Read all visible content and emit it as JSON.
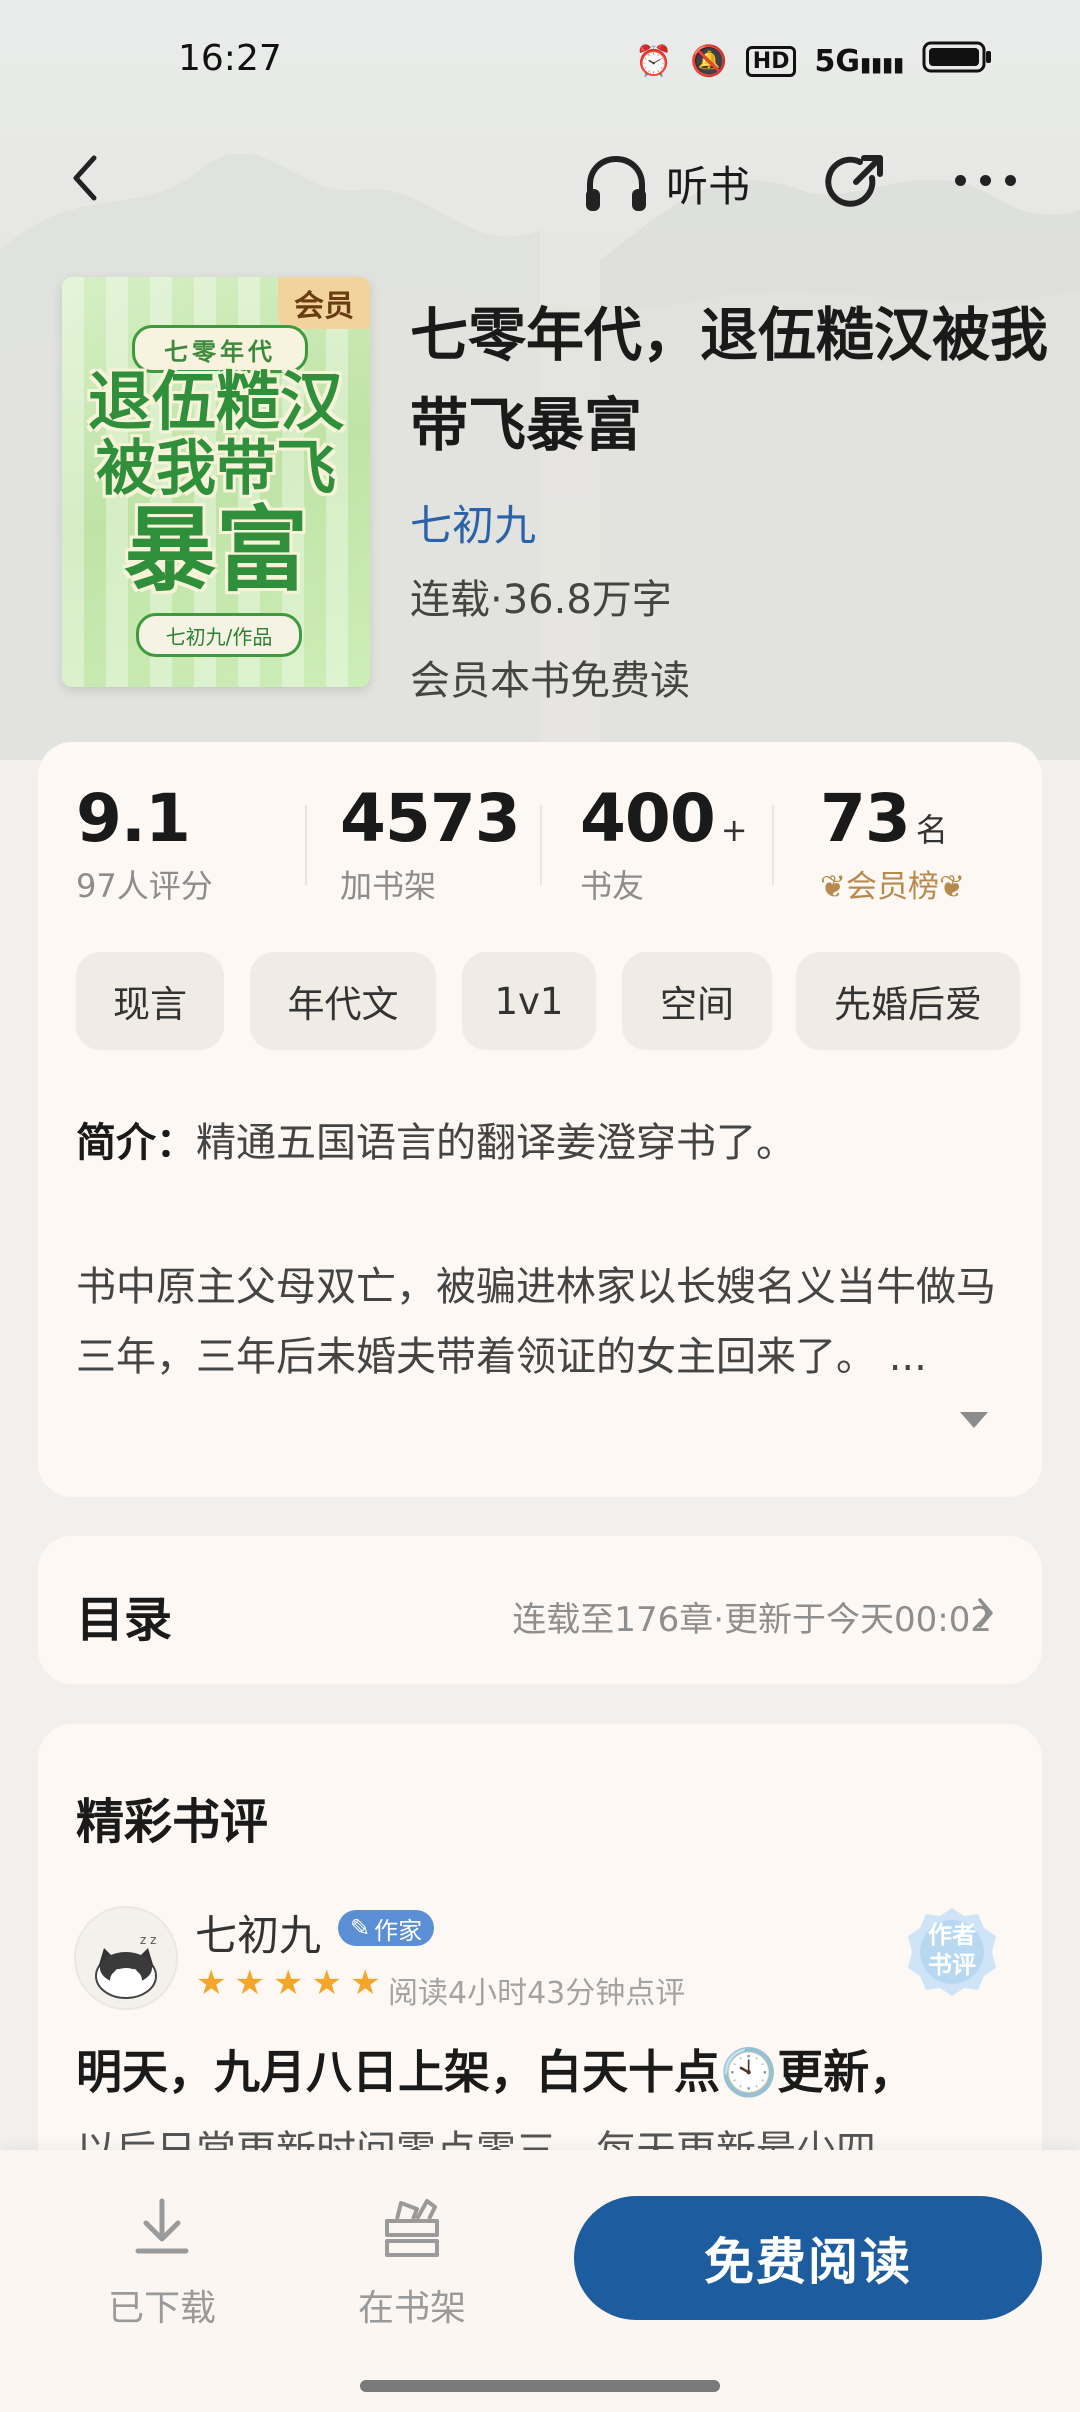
{
  "status_bar": {
    "time": "16:27",
    "network": "5G",
    "hd": "HD"
  },
  "nav": {
    "listen_label": "听书"
  },
  "book": {
    "cover_badge": "会员",
    "cover_subtitle": "七零年代",
    "cover_line1": "退伍糙汉",
    "cover_line2": "被我带飞",
    "cover_line3": "暴富",
    "cover_author": "七初九/作品",
    "title": "七零年代，退伍糙汉被我带飞暴富",
    "author": "七初九",
    "meta": "连载·36.8万字",
    "vip_note": "会员本书免费读"
  },
  "stats": {
    "rating": {
      "value": "9.1",
      "label": "97人评分"
    },
    "shelf": {
      "value": "4573",
      "label": "加书架"
    },
    "friends": {
      "value": "400",
      "suffix": "+",
      "label": "书友"
    },
    "rank": {
      "value": "73",
      "suffix": "名",
      "label": "会员榜"
    }
  },
  "tags": [
    "现言",
    "年代文",
    "1v1",
    "空间",
    "先婚后爱"
  ],
  "intro": {
    "label": "简介：",
    "line1": "精通五国语言的翻译姜澄穿书了。",
    "body": "书中原主父母双亡，被骗进林家以长嫂名义当牛做马三年，三年后未婚夫带着领证的女主回来了。 ..."
  },
  "toc": {
    "title": "目录",
    "info": "连载至176章·更新于今天00:02"
  },
  "reviews": {
    "title": "精彩书评",
    "items": [
      {
        "name": "七初九",
        "badge": "作家",
        "stars": 5,
        "meta": "阅读4小时43分钟点评",
        "seal": "作者书评",
        "headline": "明天，九月八日上架，白天十点🕙更新，",
        "body": "以后日常更新时间零点零三，每天更新最少四"
      }
    ]
  },
  "bottom": {
    "download": "已下载",
    "shelf": "在书架",
    "read": "免费阅读"
  },
  "colors": {
    "accent": "#1d5c9e",
    "author_link": "#2c62a8",
    "star": "#f4a62a",
    "rank_gold": "#b8894c"
  }
}
